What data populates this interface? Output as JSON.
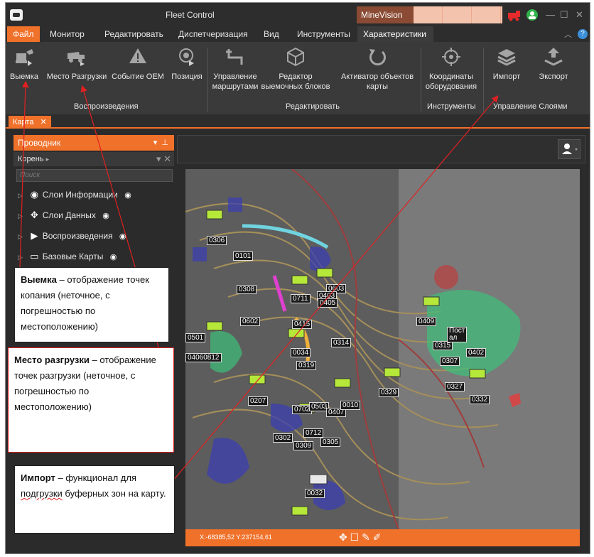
{
  "window": {
    "title": "Fleet Control",
    "brand_button": "MineVision",
    "controls": [
      "—",
      "☐",
      "✕"
    ]
  },
  "menu": {
    "items": [
      "Файл",
      "Монитор",
      "Редактировать",
      "Диспетчеризация",
      "Вид",
      "Инструменты",
      "Характеристики"
    ],
    "active": "Файл",
    "selected": "Характеристики"
  },
  "ribbon": {
    "groups": [
      {
        "label": "Воспроизведения",
        "buttons": [
          "Выемка",
          "Место Разгрузки",
          "Событие ОЕМ",
          "Позиция"
        ]
      },
      {
        "label": "Редактировать",
        "buttons": [
          "Управление маршрутами",
          "Редактор выемочных блоков",
          "Активатор объектов карты"
        ]
      },
      {
        "label": "Инструменты",
        "buttons": [
          "Координаты оборудования"
        ]
      },
      {
        "label": "Управление Слоями",
        "buttons": [
          "Импорт",
          "Экспорт"
        ]
      }
    ]
  },
  "doc_tab": {
    "label": "Карта",
    "close": "✕"
  },
  "explorer": {
    "title": "Проводник",
    "root_label": "Корень",
    "search_placeholder": "Поиск",
    "tree": [
      {
        "label": "Слои Информации",
        "icon": "target-icon"
      },
      {
        "label": "Слои Данных",
        "icon": "sparkle-icon"
      },
      {
        "label": "Воспроизведения",
        "icon": "play-icon"
      },
      {
        "label": "Базовые Карты",
        "icon": "map-icon"
      }
    ]
  },
  "map": {
    "labels": [
      "0306",
      "0101",
      "0308",
      "0603",
      "0403",
      "0711",
      "0405",
      "0602",
      "0415",
      "0314",
      "0034",
      "0501",
      "04060812",
      "0319",
      "0329",
      "0207",
      "0702",
      "0503",
      "0407",
      "0010",
      "0302",
      "0712",
      "0309",
      "0305",
      "0409",
      "0315",
      "0402",
      "0307",
      "0327",
      "0332",
      "0032"
    ],
    "coords": "X:-68385,52  Y:237154,61",
    "overlay_text": "Пост\nал"
  },
  "callouts": {
    "vyemka": {
      "term": "Выемка",
      "text": " – отображение точек копания (неточное, с погрешностью по местоположению)"
    },
    "razgruzka": {
      "term": "Место разгрузки",
      "text": " – отображение точек разгрузки (неточное, с погрешностью по местоположению)"
    },
    "import": {
      "term": "Импорт",
      "text_a": " – функционал для ",
      "text_wavy": "подгрузки",
      "text_b": " буферных зон на карту."
    }
  },
  "colors": {
    "accent": "#f0712a",
    "callout_border_red": "#e02020",
    "arrow": "#e02020"
  }
}
